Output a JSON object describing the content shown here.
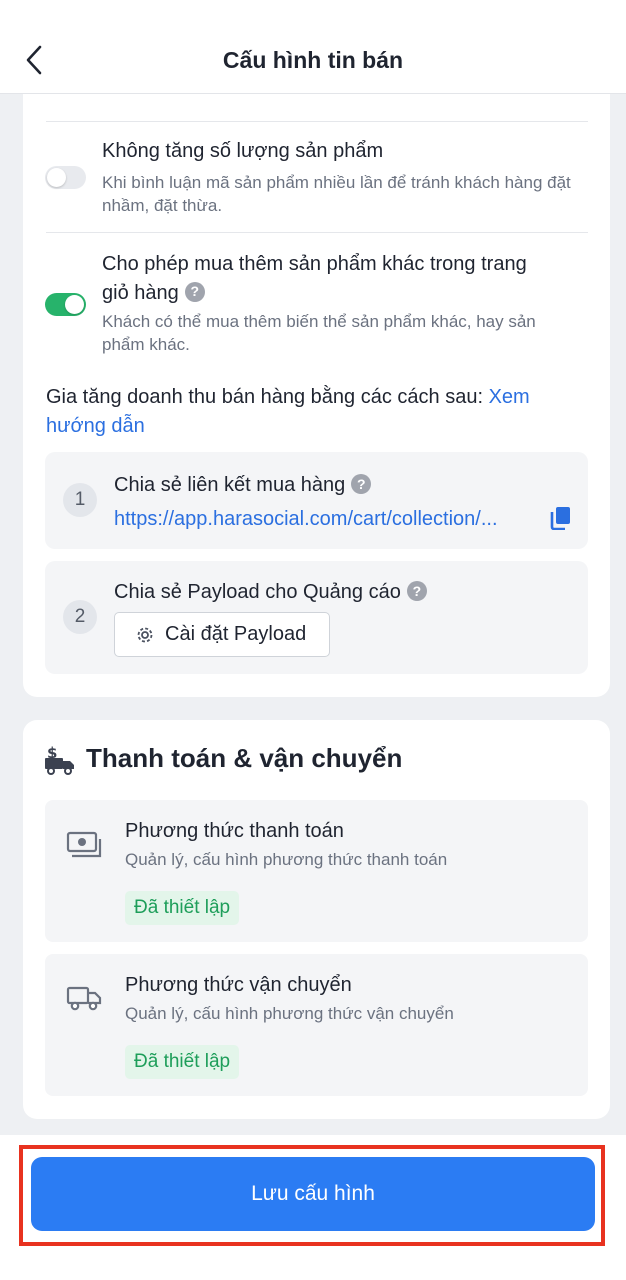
{
  "header": {
    "title": "Cấu hình tin bán"
  },
  "options": [
    {
      "title": "Không tăng số lượng sản phẩm",
      "desc": "Khi bình luận mã sản phẩm nhiều lần để tránh khách hàng đặt nhầm, đặt thừa.",
      "enabled": false
    },
    {
      "title_line1": "Cho phép mua thêm sản phẩm khác trong trang",
      "title_line2": "giỏ hàng",
      "desc": "Khách có thể mua thêm biến thể sản phẩm khác, hay sản phẩm khác.",
      "enabled": true
    }
  ],
  "growth": {
    "text": "Gia tăng doanh thu bán hàng bằng các cách sau: ",
    "link": "Xem hướng dẫn"
  },
  "steps": [
    {
      "number": "1",
      "title": "Chia sẻ liên kết mua hàng",
      "link": "https://app.harasocial.com/cart/collection/..."
    },
    {
      "number": "2",
      "title": "Chia sẻ Payload cho Quảng cáo",
      "button_label": "Cài đặt Payload"
    }
  ],
  "payment_shipping": {
    "title": "Thanh toán & vận chuyển",
    "methods": [
      {
        "title": "Phương thức thanh toán",
        "desc": "Quản lý, cấu hình phương thức thanh toán",
        "badge": "Đã thiết lập",
        "icon": "payment-icon"
      },
      {
        "title": "Phương thức vận chuyển",
        "desc": "Quản lý, cấu hình phương thức vận chuyển",
        "badge": "Đã thiết lập",
        "icon": "truck-icon"
      }
    ]
  },
  "footer": {
    "save_label": "Lưu cấu hình"
  },
  "colors": {
    "primary": "#2b7cf3",
    "toggle_on": "#27b36b",
    "link": "#2b6fe0",
    "badge_bg": "#e3f5ea",
    "badge_text": "#1e9e5a",
    "highlight": "#e8321f"
  }
}
